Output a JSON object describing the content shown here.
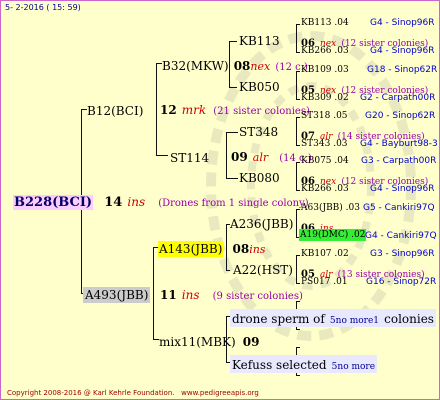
{
  "header": {
    "date": "5- 2-2016 ( 15: 59)"
  },
  "footer": {
    "copyright": "Copyright 2008-2016 @ Karl Kehrle Foundation.",
    "url": "www.pedigreeapis.org"
  },
  "root": {
    "code": "B228(BCI)",
    "num": "14",
    "race": "ins",
    "note": "(Drones from 1 single colony)"
  },
  "g1": {
    "top": {
      "code": "B12(BCI)",
      "num": "12",
      "race": "mrk",
      "note": "(21 sister colonies)"
    },
    "bottom": {
      "code": "A493(JBB)",
      "num": "11",
      "race": "ins",
      "note": "(9 sister colonies)"
    }
  },
  "g2": {
    "a": {
      "code": "B32(MKW)",
      "num": "08",
      "race": "nex",
      "note": "(12 c.)"
    },
    "b": {
      "code": "ST114",
      "num": "09",
      "race": "alr",
      "note": "(14 c.)"
    },
    "c": {
      "code": "A143(JBB)",
      "num": "08",
      "race": "ins"
    },
    "d": {
      "code": "mix11(MBK)",
      "num": "09"
    }
  },
  "g3": {
    "a": "KB113",
    "b": "KB050",
    "c": "ST348",
    "d": "KB080",
    "e": "A236(JBB)",
    "f": "A22(HST)",
    "g": "drone sperm of",
    "g_mid": "5no more1",
    "g_end": "colonies",
    "h": "Kefuss selected",
    "h_end": "5no more"
  },
  "g4": [
    {
      "code": "KB113 .04",
      "ref": "G4 - Sinop96R"
    },
    {
      "num": "06",
      "race": "nex",
      "note": "(12 sister colonies)"
    },
    {
      "code": "KB266 .03",
      "ref": "G4 - Sinop96R"
    },
    {
      "code": "KB109 .03",
      "ref": "G18 - Sinop62R"
    },
    {
      "num": "05",
      "race": "nex",
      "note": "(12 sister colonies)"
    },
    {
      "code": "KB309 .02",
      "ref": "G2 - Carpath00R"
    },
    {
      "code": "ST318 .05",
      "ref": "G20 - Sinop62R"
    },
    {
      "num": "07",
      "race": "alr",
      "note": "(14 sister colonies)"
    },
    {
      "code": "ST343 .03",
      "ref": "G4 - Bayburt98-3"
    },
    {
      "code": "KB075 .04",
      "ref": "G3 - Carpath00R"
    },
    {
      "num": "06",
      "race": "nex",
      "note": "(12 sister colonies)"
    },
    {
      "code": "KB266 .03",
      "ref": "G4 - Sinop96R"
    },
    {
      "code": "A63(JBB) .03",
      "ref": "G5 - Cankiri97Q"
    },
    {
      "num": "06",
      "race": "ins",
      "note": ""
    },
    {
      "code": "A19(DMC) .02",
      "ref": "G4 - Cankiri97Q"
    },
    {
      "code": "KB107 .02",
      "ref": "G3 - Sinop96R"
    },
    {
      "num": "05",
      "race": "alr",
      "note": "(13 sister colonies)"
    },
    {
      "code": "PS017 .01",
      "ref": "G16 - Sinop72R"
    }
  ],
  "colors": {
    "background": "#ffffcc",
    "border": "#cc66cc",
    "highlight_yellow": "#ffff00",
    "highlight_green": "#33ee33",
    "race": "#cc0000",
    "note": "#9900aa",
    "ref": "#0000cc"
  }
}
